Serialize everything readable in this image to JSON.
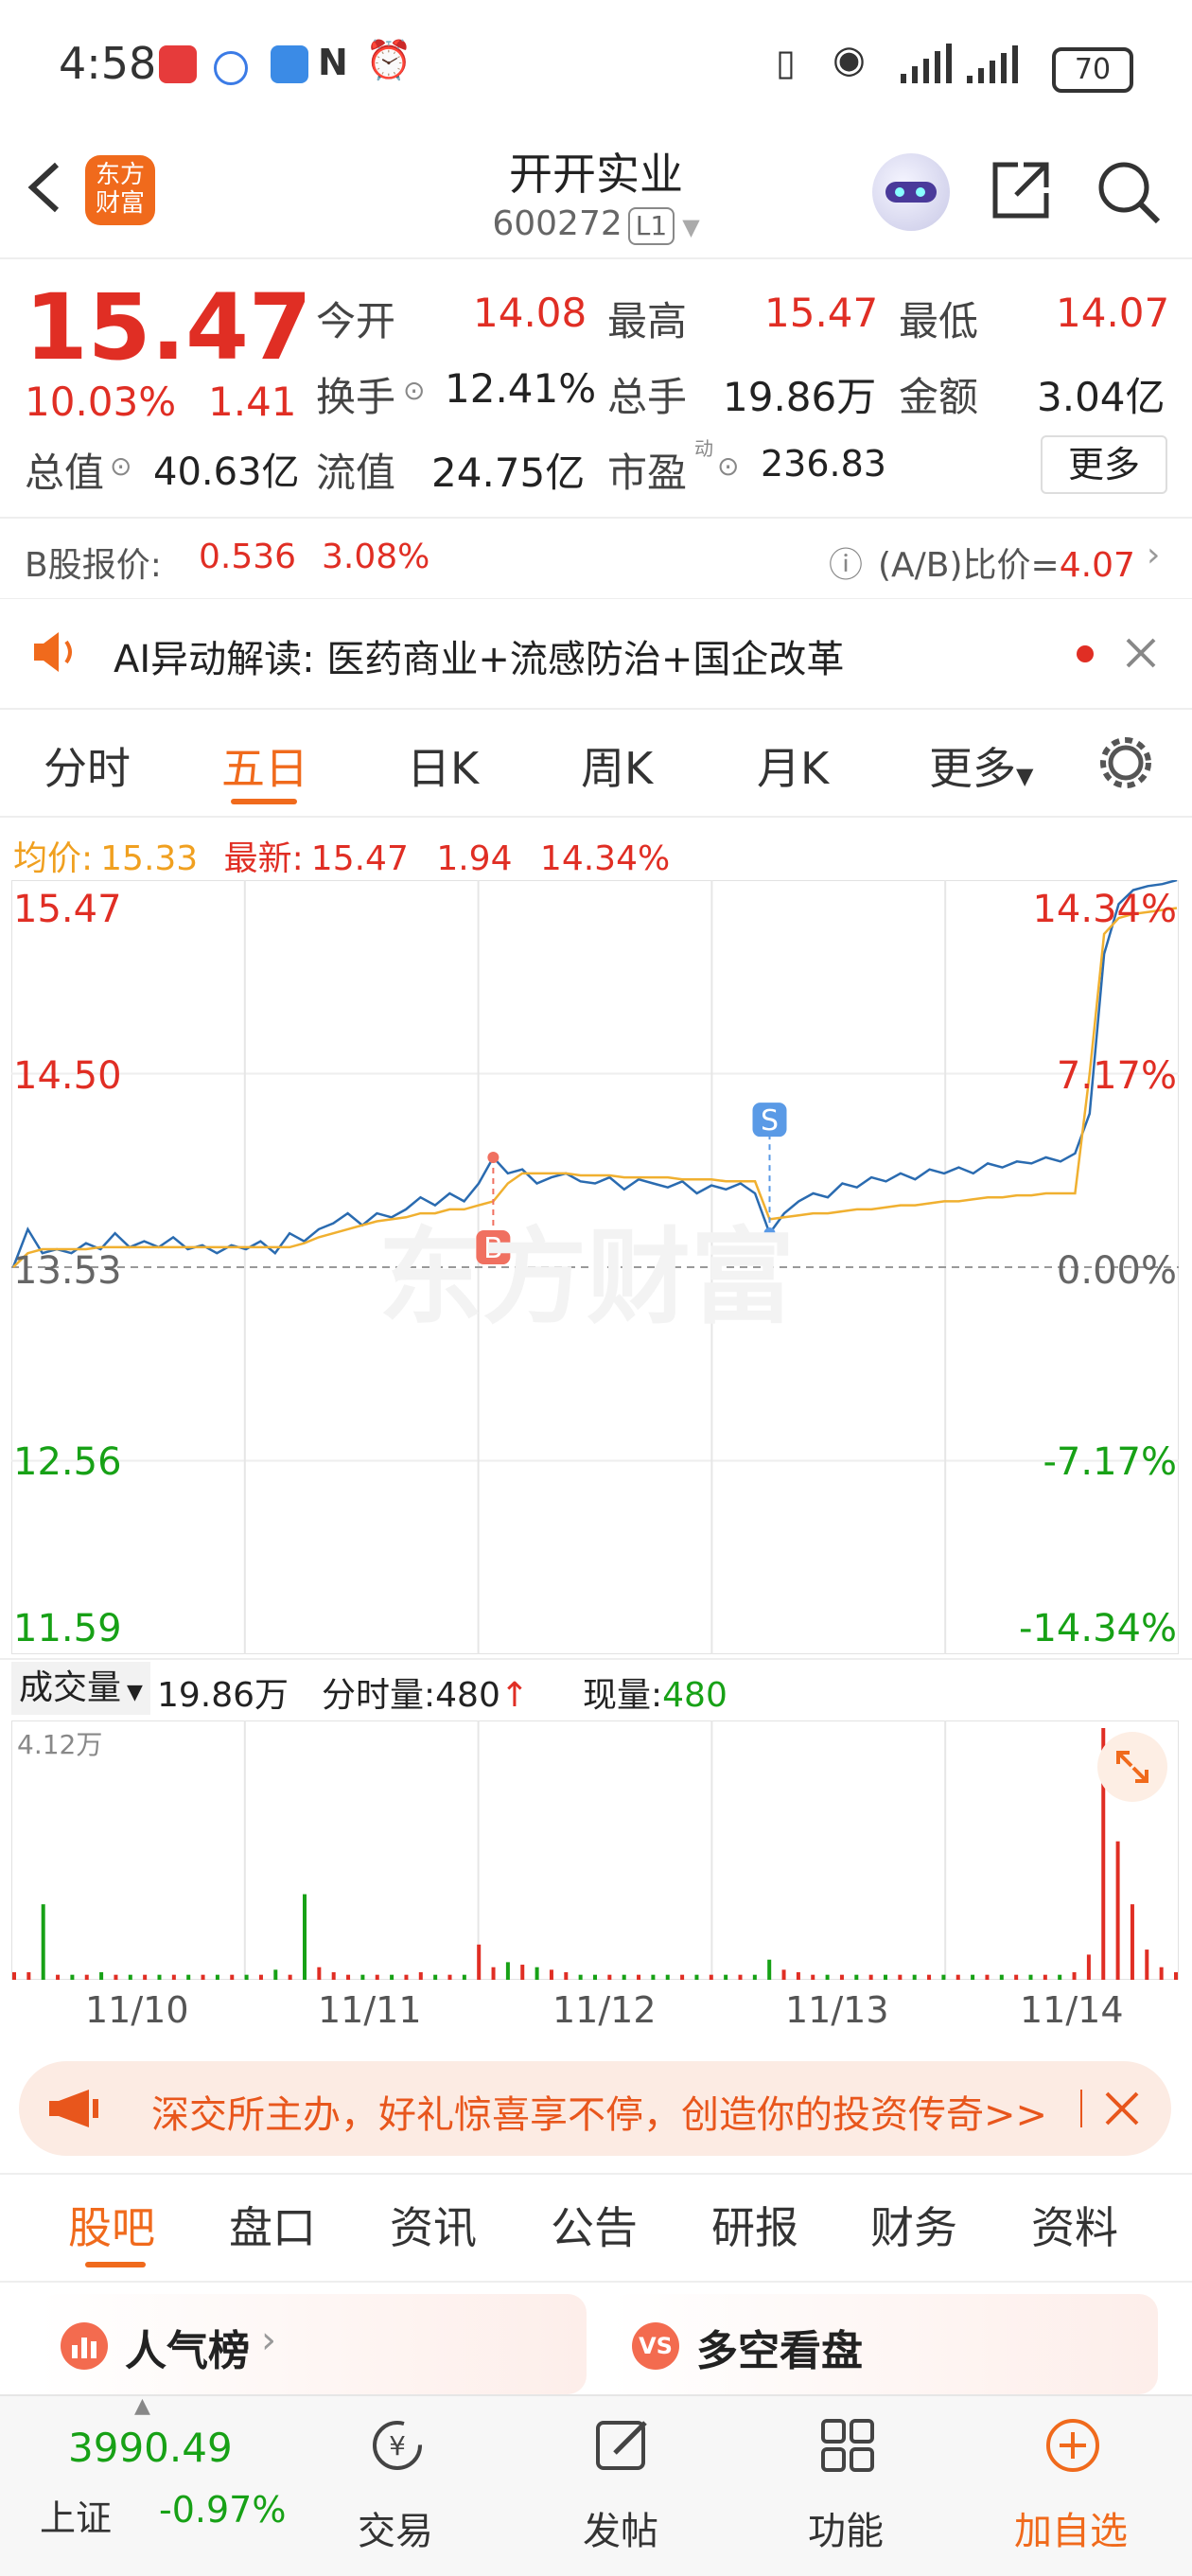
{
  "status": {
    "time": "4:58",
    "battery": "70"
  },
  "header": {
    "logo_line1": "东方",
    "logo_line2": "财富",
    "title": "开开实业",
    "code": "600272",
    "level": "L1"
  },
  "quote": {
    "price": "15.47",
    "change_pct": "10.03%",
    "change": "1.41",
    "open_label": "今开",
    "open": "14.08",
    "high_label": "最高",
    "high": "15.47",
    "low_label": "最低",
    "low": "14.07",
    "turnover_label": "换手",
    "turnover": "12.41%",
    "volume_label": "总手",
    "volume": "19.86万",
    "amount_label": "金额",
    "amount": "3.04亿",
    "mktcap_label": "总值",
    "mktcap": "40.63亿",
    "float_label": "流值",
    "float": "24.75亿",
    "pe_label": "市盈",
    "pe_sup": "动",
    "pe": "236.83",
    "more": "更多"
  },
  "bshare": {
    "label": "B股报价:",
    "price": "0.536",
    "pct": "3.08%",
    "ratio_label": "(A/B)比价=",
    "ratio": "4.07"
  },
  "ai": {
    "text": "AI异动解读:  医药商业+流感防治+国企改革"
  },
  "ktabs": [
    "分时",
    "五日",
    "日K",
    "周K",
    "月K",
    "更多"
  ],
  "legend": {
    "avg_label": "均价:",
    "avg": "15.33",
    "last_label": "最新:",
    "last": "15.47",
    "chg": "1.94",
    "pct": "14.34%"
  },
  "chart_data": {
    "type": "line",
    "title": "",
    "x": [
      "11/10",
      "11/11",
      "11/12",
      "11/13",
      "11/14"
    ],
    "y_labels_left": [
      "15.47",
      "14.50",
      "13.53",
      "12.56",
      "11.59"
    ],
    "y_labels_right": [
      "14.34%",
      "7.17%",
      "0.00%",
      "-7.17%",
      "-14.34%"
    ],
    "ylim": [
      11.59,
      15.47
    ],
    "prev_close": 13.53,
    "grid": true,
    "series": [
      {
        "name": "",
        "color": "#2a6bb0",
        "values": [
          13.53,
          13.72,
          13.6,
          13.62,
          13.6,
          13.65,
          13.62,
          13.7,
          13.63,
          13.66,
          13.63,
          13.68,
          13.62,
          13.64,
          13.6,
          13.64,
          13.62,
          13.66,
          13.6,
          13.7,
          13.66,
          13.72,
          13.75,
          13.8,
          13.74,
          13.8,
          13.78,
          13.82,
          13.88,
          13.84,
          13.9,
          13.86,
          13.95,
          14.08,
          14.0,
          14.02,
          13.95,
          13.98,
          14.0,
          13.96,
          13.95,
          13.98,
          13.92,
          13.97,
          13.95,
          13.93,
          13.96,
          13.9,
          13.94,
          13.92,
          13.95,
          13.9,
          13.7,
          13.8,
          13.86,
          13.9,
          13.88,
          13.95,
          13.93,
          13.98,
          13.96,
          14.0,
          13.97,
          14.02,
          14.0,
          14.03,
          14.0,
          14.05,
          14.03,
          14.06,
          14.05,
          14.08,
          14.06,
          14.1,
          14.3,
          15.1,
          15.35,
          15.42,
          15.44,
          15.45,
          15.47
        ]
      },
      {
        "name": "",
        "color": "#f0b030",
        "values": [
          13.53,
          13.6,
          13.62,
          13.62,
          13.62,
          13.62,
          13.63,
          13.63,
          13.63,
          13.63,
          13.63,
          13.63,
          13.63,
          13.63,
          13.63,
          13.63,
          13.63,
          13.63,
          13.63,
          13.63,
          13.65,
          13.68,
          13.7,
          13.72,
          13.74,
          13.76,
          13.77,
          13.78,
          13.8,
          13.8,
          13.82,
          13.82,
          13.84,
          13.86,
          13.95,
          14.0,
          14.0,
          14.0,
          14.0,
          13.99,
          13.99,
          13.99,
          13.98,
          13.98,
          13.98,
          13.98,
          13.97,
          13.97,
          13.97,
          13.96,
          13.96,
          13.96,
          13.77,
          13.78,
          13.79,
          13.8,
          13.8,
          13.81,
          13.82,
          13.82,
          13.83,
          13.84,
          13.84,
          13.85,
          13.86,
          13.86,
          13.87,
          13.88,
          13.88,
          13.89,
          13.89,
          13.9,
          13.9,
          13.9,
          14.5,
          15.2,
          15.28,
          15.3,
          15.31,
          15.32,
          15.33
        ]
      }
    ],
    "markers": [
      {
        "label": "B",
        "x_index": 33,
        "value": 14.08
      },
      {
        "label": "S",
        "x_index": 52,
        "value": 13.7
      }
    ],
    "volume": {
      "max_label": "4.12万",
      "values": [
        0.03,
        0.03,
        0.3,
        0.02,
        0.02,
        0.02,
        0.03,
        0.02,
        0.02,
        0.02,
        0.02,
        0.02,
        0.02,
        0.02,
        0.02,
        0.02,
        0.02,
        0.02,
        0.04,
        0.02,
        0.34,
        0.05,
        0.03,
        0.02,
        0.02,
        0.02,
        0.02,
        0.02,
        0.03,
        0.02,
        0.02,
        0.02,
        0.14,
        0.05,
        0.07,
        0.06,
        0.05,
        0.04,
        0.03,
        0.02,
        0.02,
        0.02,
        0.02,
        0.02,
        0.02,
        0.02,
        0.02,
        0.02,
        0.02,
        0.02,
        0.02,
        0.02,
        0.08,
        0.04,
        0.03,
        0.02,
        0.02,
        0.02,
        0.02,
        0.02,
        0.02,
        0.02,
        0.02,
        0.02,
        0.02,
        0.02,
        0.02,
        0.02,
        0.02,
        0.02,
        0.02,
        0.02,
        0.02,
        0.03,
        0.1,
        1.0,
        0.55,
        0.3,
        0.12,
        0.05,
        0.03
      ]
    }
  },
  "volbar": {
    "label": "成交量",
    "total": "19.86万",
    "tick_label": "分时量:",
    "tick": "480",
    "now_label": "现量:",
    "now": "480"
  },
  "ad": {
    "text": "深交所主办，好礼惊喜享不停，创造你的投资传奇>>"
  },
  "subtabs": [
    "股吧",
    "盘口",
    "资讯",
    "公告",
    "研报",
    "财务",
    "资料"
  ],
  "cards": {
    "hot": "人气榜",
    "ls": "多空看盘"
  },
  "index": {
    "value": "3990.49",
    "name": "上证",
    "pct": "-0.97%"
  },
  "nav": {
    "trade": "交易",
    "post": "发帖",
    "func": "功能",
    "add": "加自选"
  },
  "colors": {
    "up": "#e02e24",
    "down": "#17a116",
    "accent": "#f06a1c",
    "price_line": "#2a6bb0",
    "avg_line": "#f0b030"
  }
}
